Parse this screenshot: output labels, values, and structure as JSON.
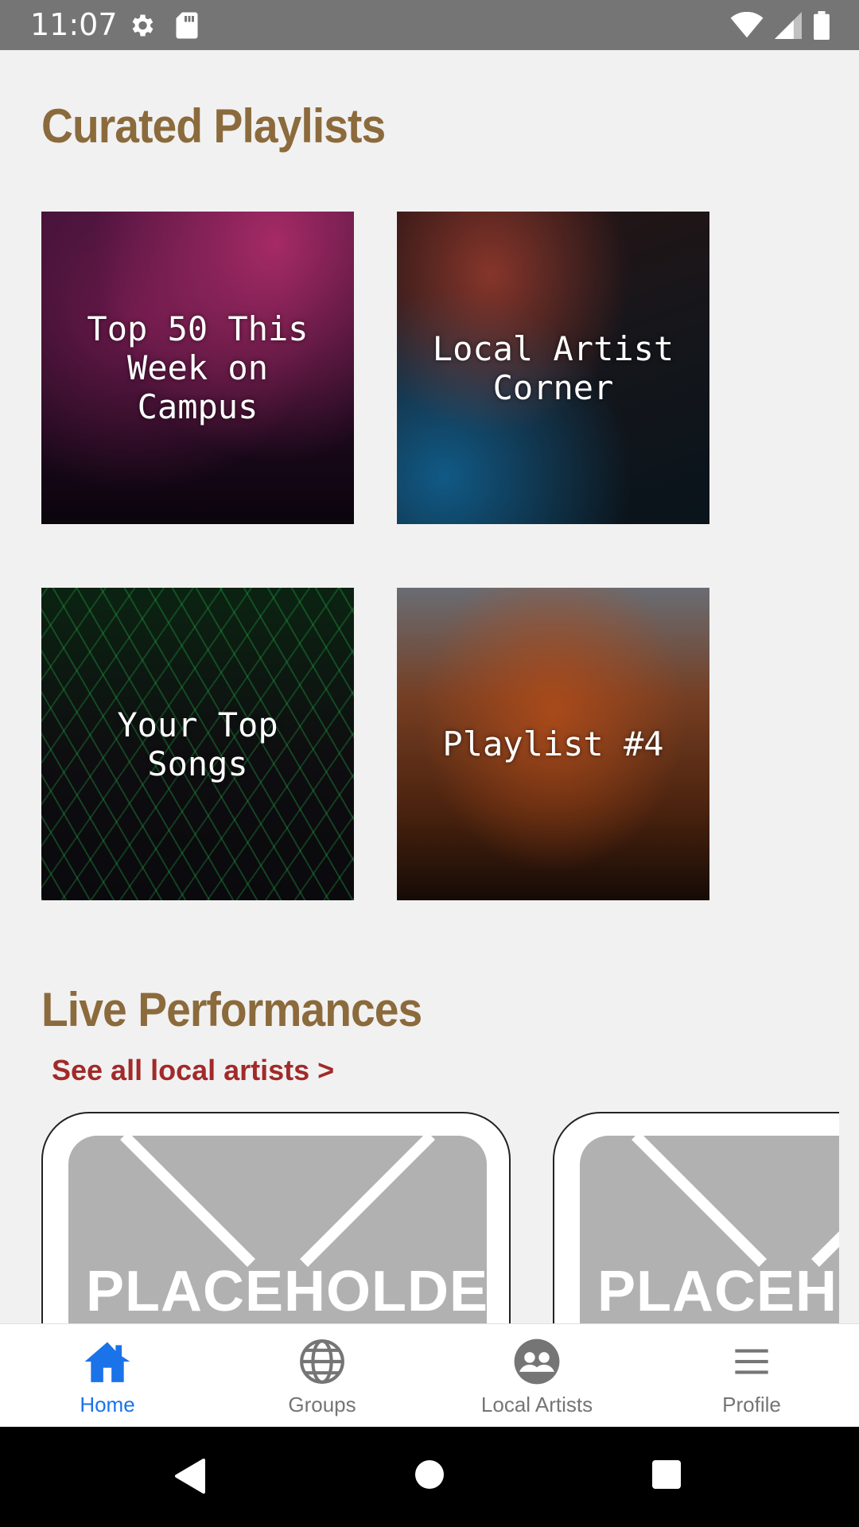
{
  "status_bar": {
    "time": "11:07"
  },
  "sections": {
    "playlists_title": "Curated Playlists",
    "live_title": "Live Performances",
    "see_all": "See all local artists >"
  },
  "playlists": [
    {
      "label": "Top 50 This Week on Campus"
    },
    {
      "label": "Local Artist Corner"
    },
    {
      "label": "Your Top Songs"
    },
    {
      "label": "Playlist #4"
    }
  ],
  "artist_cards": [
    {
      "placeholder": "PLACEHOLDER"
    },
    {
      "placeholder": "PLACEHOLDER"
    }
  ],
  "bottom_nav": [
    {
      "label": "Home",
      "icon": "home-icon",
      "active": true
    },
    {
      "label": "Groups",
      "icon": "globe-icon",
      "active": false
    },
    {
      "label": "Local Artists",
      "icon": "group-icon",
      "active": false
    },
    {
      "label": "Profile",
      "icon": "menu-icon",
      "active": false
    }
  ],
  "colors": {
    "heading": "#8b6a3c",
    "link": "#a12a2a",
    "active_nav": "#1a73e8",
    "inactive_nav": "#757575"
  }
}
